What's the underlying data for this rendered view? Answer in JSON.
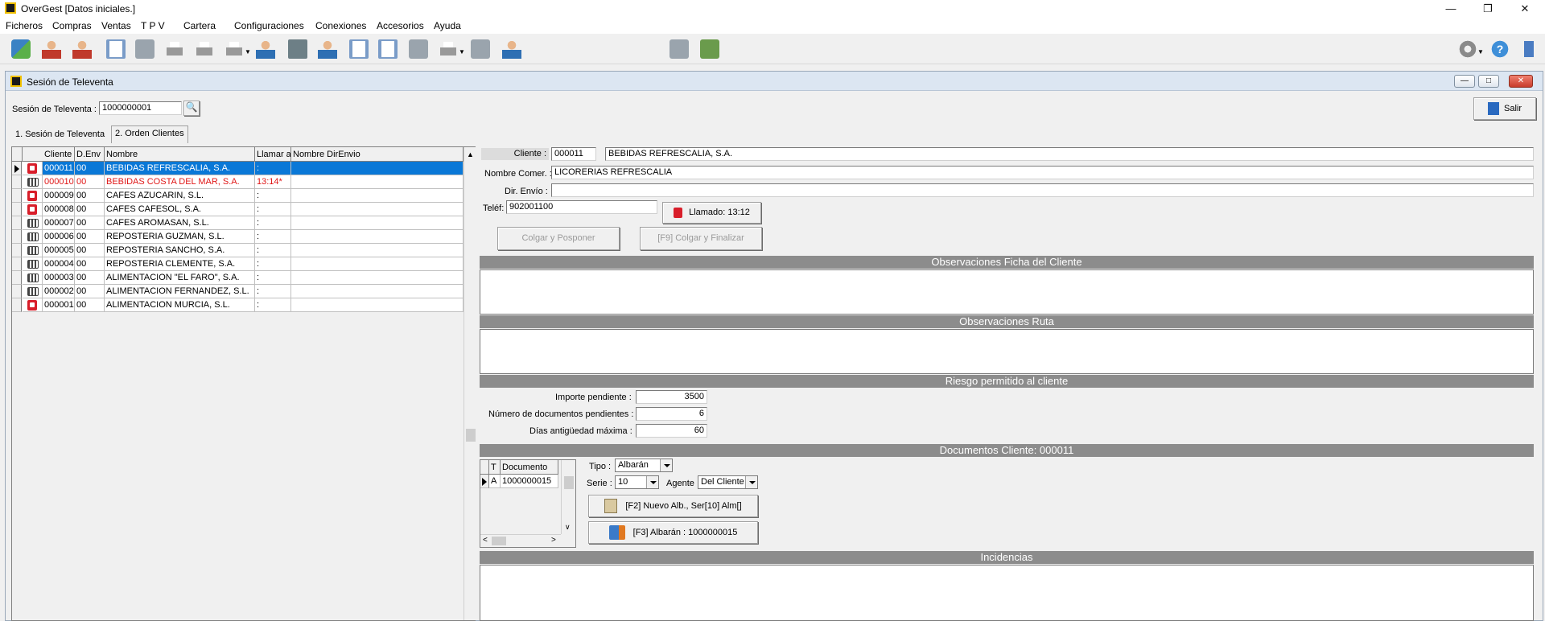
{
  "window": {
    "title": "OverGest  [Datos iniciales.]"
  },
  "menu": [
    "Ficheros",
    "Compras",
    "Ventas",
    "T P V",
    "Cartera",
    "Configuraciones",
    "Conexiones",
    "Accesorios",
    "Ayuda"
  ],
  "child": {
    "title": "Sesión de Televenta"
  },
  "session": {
    "label": "Sesión de Televenta :",
    "value": "1000000001"
  },
  "exit_button": "Salir",
  "tabs": [
    "1. Sesión de Televenta",
    "2. Orden Clientes"
  ],
  "grid": {
    "headers": [
      "Cliente",
      "D.Env",
      "Nombre",
      "Llamar a",
      "Nombre DirEnvio"
    ],
    "rows": [
      {
        "cliente": "000011",
        "denv": "00",
        "nombre": "BEBIDAS REFRESCALIA, S.A.",
        "llamar": ":",
        "dir": "",
        "icon": "phone-red-icon",
        "selected": true,
        "red": false
      },
      {
        "cliente": "000010",
        "denv": "00",
        "nombre": "BEBIDAS COSTA DEL MAR, S.A.",
        "llamar": "13:14*",
        "dir": "",
        "icon": "phone-gray-icon",
        "selected": false,
        "red": true
      },
      {
        "cliente": "000009",
        "denv": "00",
        "nombre": "CAFES AZUCARIN, S.L.",
        "llamar": ":",
        "dir": "",
        "icon": "phone-red-icon",
        "selected": false,
        "red": false
      },
      {
        "cliente": "000008",
        "denv": "00",
        "nombre": "CAFES CAFESOL, S.A.",
        "llamar": ":",
        "dir": "",
        "icon": "phone-red-icon",
        "selected": false,
        "red": false
      },
      {
        "cliente": "000007",
        "denv": "00",
        "nombre": "CAFES AROMASAN, S.L.",
        "llamar": ":",
        "dir": "",
        "icon": "phone-gray-icon",
        "selected": false,
        "red": false
      },
      {
        "cliente": "000006",
        "denv": "00",
        "nombre": "REPOSTERIA GUZMAN, S.L.",
        "llamar": ":",
        "dir": "",
        "icon": "phone-gray-icon",
        "selected": false,
        "red": false
      },
      {
        "cliente": "000005",
        "denv": "00",
        "nombre": "REPOSTERIA SANCHO, S.A.",
        "llamar": ":",
        "dir": "",
        "icon": "phone-gray-icon",
        "selected": false,
        "red": false
      },
      {
        "cliente": "000004",
        "denv": "00",
        "nombre": "REPOSTERIA CLEMENTE, S.A.",
        "llamar": ":",
        "dir": "",
        "icon": "phone-gray-icon",
        "selected": false,
        "red": false
      },
      {
        "cliente": "000003",
        "denv": "00",
        "nombre": "ALIMENTACION \"EL FARO\", S.A.",
        "llamar": ":",
        "dir": "",
        "icon": "phone-gray-icon",
        "selected": false,
        "red": false
      },
      {
        "cliente": "000002",
        "denv": "00",
        "nombre": "ALIMENTACION FERNANDEZ, S.L.",
        "llamar": ":",
        "dir": "",
        "icon": "phone-gray-icon",
        "selected": false,
        "red": false
      },
      {
        "cliente": "000001",
        "denv": "00",
        "nombre": "ALIMENTACION MURCIA, S.L.",
        "llamar": ":",
        "dir": "",
        "icon": "phone-red-icon",
        "selected": false,
        "red": false
      }
    ]
  },
  "client": {
    "cliente_label": "Cliente :",
    "cliente_code": "000011",
    "cliente_name": "BEBIDAS REFRESCALIA, S.A.",
    "nombre_comer_label": "Nombre Comer. :",
    "nombre_comer": "LICORERIAS REFRESCALIA",
    "dir_envio_label": "Dir. Envío :",
    "dir_envio": "",
    "telef_label": "Teléf:",
    "telef": "902001100",
    "llamado_button": "Llamado: 13:12",
    "colgar_posponer": "Colgar y Posponer",
    "colgar_finalizar": "[F9] Colgar y Finalizar"
  },
  "sections": {
    "obs_ficha": "Observaciones Ficha del Cliente",
    "obs_ruta": "Observaciones Ruta",
    "riesgo": "Riesgo permitido al cliente",
    "documentos": "Documentos Cliente: 000011",
    "incidencias": "Incidencias"
  },
  "riesgo": {
    "importe_label": "Importe pendiente :",
    "importe": "3500",
    "num_docs_label": "Número de documentos pendientes :",
    "num_docs": "6",
    "dias_label": "Días antigüedad máxima :",
    "dias": "60"
  },
  "docs": {
    "headers": [
      "T",
      "Documento"
    ],
    "rows": [
      {
        "t": "A",
        "doc": "1000000015"
      }
    ],
    "tipo_label": "Tipo :",
    "tipo": "Albarán",
    "serie_label": "Serie :",
    "serie": "10",
    "agente_label": "Agente",
    "agente": "Del Cliente",
    "nuevo_button": "[F2] Nuevo Alb., Ser[10] Alm[]",
    "albaran_button": "[F3] Albarán : 1000000015"
  }
}
